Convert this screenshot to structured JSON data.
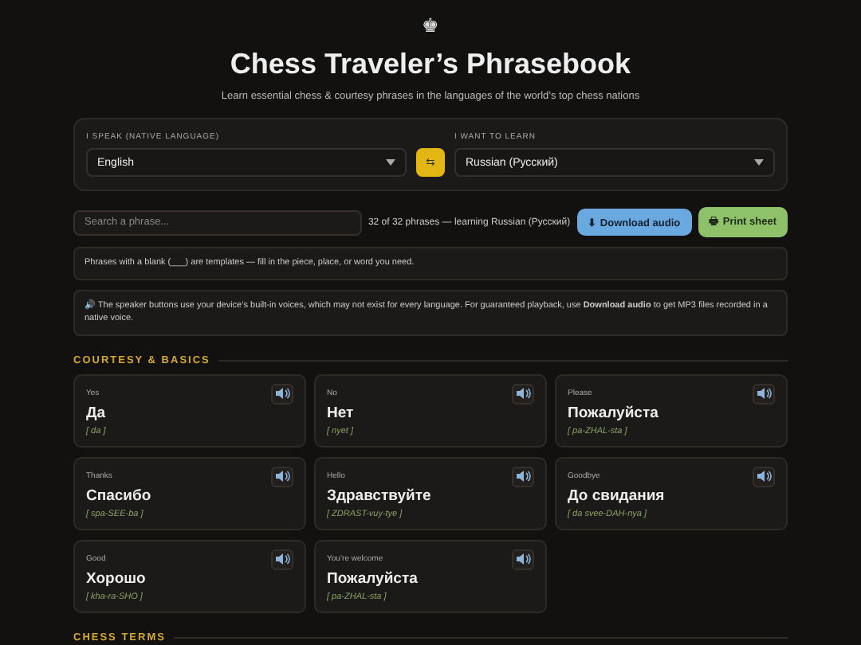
{
  "header": {
    "logo": "♚",
    "title": "Chess Traveler’s Phrasebook",
    "subtitle": "Learn essential chess & courtesy phrases in the languages of the world’s top chess nations"
  },
  "languages": {
    "native_label": "I SPEAK (NATIVE LANGUAGE)",
    "native_value": "English",
    "swap": "⇆",
    "learn_label": "I WANT TO LEARN",
    "learn_value": "Russian (Русский)"
  },
  "toolbar": {
    "search_placeholder": "Search a phrase...",
    "count": "32 of 32 phrases — learning Russian (Русский)",
    "download": "⬇ Download audio",
    "print": "🖶 Print sheet"
  },
  "notes": [
    "Phrases with a blank (___) are templates — fill in the piece, place, or word you need.",
    "🔊 The speaker buttons use your device’s built-in voices, which may not exist for every language. For guaranteed playback, use **Download audio** to get MP3 files recorded in a native voice."
  ],
  "sections": [
    {
      "title": "COURTESY & BASICS",
      "cards": [
        {
          "meaning": "Yes",
          "phrase": "Да",
          "pronunciation": "[ da ]"
        },
        {
          "meaning": "No",
          "phrase": "Нет",
          "pronunciation": "[ nyet ]"
        },
        {
          "meaning": "Please",
          "phrase": "Пожалуйста",
          "pronunciation": "[ pa-ZHAL-sta ]"
        },
        {
          "meaning": "Thanks",
          "phrase": "Спасибо",
          "pronunciation": "[ spa-SEE-ba ]"
        },
        {
          "meaning": "Hello",
          "phrase": "Здравствуйте",
          "pronunciation": "[ ZDRAST-vuy-tye ]"
        },
        {
          "meaning": "Goodbye",
          "phrase": "До свидания",
          "pronunciation": "[ da svee-DAH-nya ]"
        },
        {
          "meaning": "Good",
          "phrase": "Хорошо",
          "pronunciation": "[ kha-ra-SHO ]"
        },
        {
          "meaning": "You’re welcome",
          "phrase": "Пожалуйста",
          "pronunciation": "[ pa-ZHAL-sta ]"
        }
      ]
    },
    {
      "title": "CHESS TERMS"
    }
  ]
}
